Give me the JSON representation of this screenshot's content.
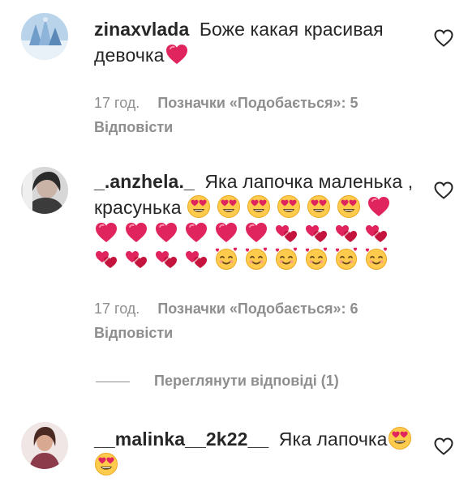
{
  "colors": {
    "text": "#262626",
    "secondary": "#8e8e8e",
    "heart": "#e0245e"
  },
  "comments": [
    {
      "username": "zinaxvlada",
      "text": "Боже какая красивая девочка",
      "emojis": [
        "red-heart"
      ],
      "time": "17 год.",
      "likes": "Позначки «Подобається»: 5",
      "reply": "Відповісти"
    },
    {
      "username": "_.anzhela._",
      "text": "Яка лапочка маленька , красунька",
      "emojis": [
        "heart-eyes",
        "heart-eyes",
        "heart-eyes",
        "heart-eyes",
        "heart-eyes",
        "heart-eyes",
        "red-heart",
        "red-heart",
        "red-heart",
        "red-heart",
        "red-heart",
        "red-heart",
        "red-heart",
        "revolving-hearts",
        "revolving-hearts",
        "revolving-hearts",
        "revolving-hearts",
        "revolving-hearts",
        "revolving-hearts",
        "revolving-hearts",
        "revolving-hearts",
        "smiling-hearts",
        "smiling-hearts",
        "smiling-hearts",
        "smiling-hearts",
        "smiling-hearts",
        "smiling-hearts"
      ],
      "time": "17 год.",
      "likes": "Позначки «Подобається»: 6",
      "reply": "Відповісти",
      "view_replies": "Переглянути відповіді (1)"
    },
    {
      "username": "__malinka__2k22__",
      "text": "Яка лапочка",
      "emojis": [
        "heart-eyes",
        "heart-eyes"
      ]
    }
  ]
}
